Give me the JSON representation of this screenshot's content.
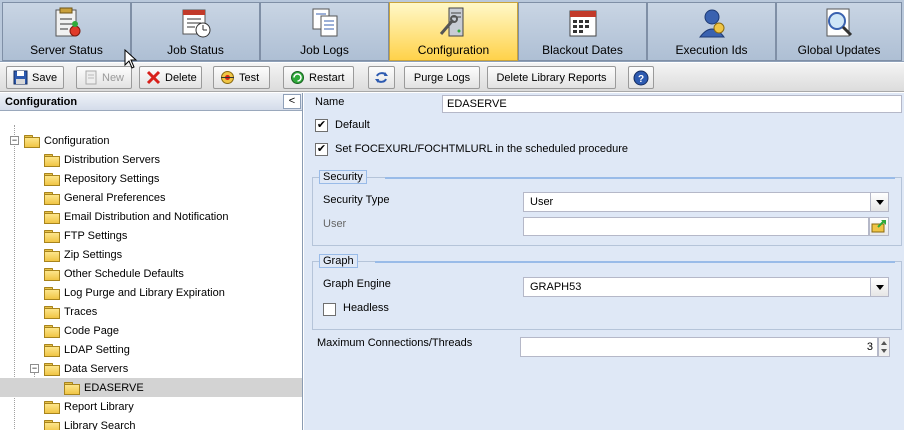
{
  "tabs": [
    {
      "label": "Server Status",
      "icon": "server-status-icon",
      "active": false
    },
    {
      "label": "Job Status",
      "icon": "job-status-icon",
      "active": false
    },
    {
      "label": "Job Logs",
      "icon": "job-logs-icon",
      "active": false
    },
    {
      "label": "Configuration",
      "icon": "configuration-icon",
      "active": true
    },
    {
      "label": "Blackout Dates",
      "icon": "calendar-icon",
      "active": false
    },
    {
      "label": "Execution Ids",
      "icon": "execution-ids-icon",
      "active": false
    },
    {
      "label": "Global Updates",
      "icon": "global-updates-icon",
      "active": false
    }
  ],
  "toolbar": {
    "save": "Save",
    "new": "New",
    "delete": "Delete",
    "test": "Test",
    "restart": "Restart",
    "purge_logs": "Purge Logs",
    "delete_library_reports": "Delete Library Reports"
  },
  "left_panel": {
    "title": "Configuration",
    "collapse": "<",
    "tree": [
      {
        "label": "Configuration",
        "level": 0,
        "toggle": "−"
      },
      {
        "label": "Distribution Servers",
        "level": 1
      },
      {
        "label": "Repository Settings",
        "level": 1
      },
      {
        "label": "General Preferences",
        "level": 1
      },
      {
        "label": "Email Distribution and Notification",
        "level": 1
      },
      {
        "label": "FTP Settings",
        "level": 1
      },
      {
        "label": "Zip Settings",
        "level": 1
      },
      {
        "label": "Other Schedule Defaults",
        "level": 1
      },
      {
        "label": "Log Purge and Library Expiration",
        "level": 1
      },
      {
        "label": "Traces",
        "level": 1
      },
      {
        "label": "Code Page",
        "level": 1
      },
      {
        "label": "LDAP Setting",
        "level": 1
      },
      {
        "label": "Data Servers",
        "level": 1,
        "toggle": "−"
      },
      {
        "label": "EDASERVE",
        "level": 2,
        "selected": true
      },
      {
        "label": "Report Library",
        "level": 1
      },
      {
        "label": "Library Search",
        "level": 1
      }
    ]
  },
  "form": {
    "name_label": "Name",
    "name_value": "EDASERVE",
    "default_label": "Default",
    "default_checked": "✔",
    "focexurl_label": "Set FOCEXURL/FOCHTMLURL in the scheduled procedure",
    "focexurl_checked": "✔",
    "security": {
      "legend": "Security",
      "type_label": "Security Type",
      "type_value": "User",
      "user_label": "User",
      "user_value": ""
    },
    "graph": {
      "legend": "Graph",
      "engine_label": "Graph Engine",
      "engine_value": "GRAPH53",
      "headless_label": "Headless",
      "headless_checked": ""
    },
    "max_conn_label": "Maximum Connections/Threads",
    "max_conn_value": "3"
  }
}
